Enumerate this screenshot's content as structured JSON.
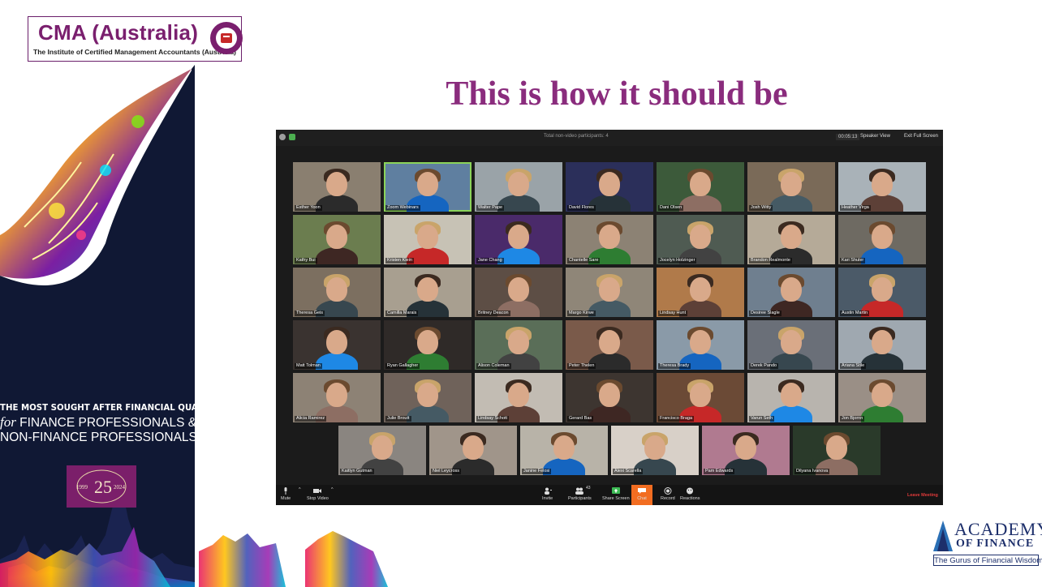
{
  "logo": {
    "name": "CMA (Australia)",
    "subtitle": "The Institute of Certified Management Accountants (Australia)"
  },
  "heading": "This is how it should be",
  "tagline": {
    "line1": "THE MOST SOUGHT AFTER FINANCIAL QUALIFICATION",
    "line2_italic": "for",
    "line2_rest": "FINANCE PROFESSIONALS &",
    "line3": "NON-FINANCE PROFESSIONALS"
  },
  "anniversary": {
    "start": "1999",
    "number": "25",
    "end": "2024"
  },
  "zoom": {
    "window_title": "Total non-video participants: 4",
    "timer": "00:05:13",
    "speaker_view": "Speaker View",
    "exit_full_screen": "Exit Full Screen",
    "participants": [
      "Esther Yoon",
      "Zoom Webinars",
      "Walter Pape",
      "David Flores",
      "Dani Olsen",
      "Josh Witty",
      "Heather Virga",
      "Kathy Bui",
      "Kristen Klein",
      "Jane Chang",
      "Chantelle Sare",
      "Jocelyn Holzinger",
      "Brandon Realmonte",
      "Kari Shuler",
      "Theresa Geis",
      "Camilla Marais",
      "Britney Deacon",
      "Margo Kirwe",
      "Lindsay Hunt",
      "Desiree Slagle",
      "Austin Martin",
      "Matt Tolman",
      "Ryan Gallagher",
      "Alison Coleman",
      "Peter Thelen",
      "Theresa Brady",
      "Derek Pando",
      "Ariana Stile",
      "Alicia Ramirez",
      "Julie Broutt",
      "Lindsay Schott",
      "Gerard Bas",
      "Francisco Braga",
      "Varun Seth",
      "Jon Bjornn",
      "Kaitlyn Gutman",
      "Niel Leycross",
      "Janine Felosi",
      "Alexi Scarella",
      "Pam Edwards",
      "Dilyana Ivanova"
    ],
    "toolbar": {
      "mute": "Mute",
      "stop_video": "Stop Video",
      "invite": "Invite",
      "participants": "Participants",
      "participants_count": "43",
      "share_screen": "Share Screen",
      "chat": "Chat",
      "record": "Record",
      "reactions": "Reactions",
      "leave": "Leave Meeting"
    }
  },
  "academy": {
    "name": "ACADEMY",
    "sub": "OF FINANCE",
    "tagline": "The Gurus of Financial Wisdom"
  },
  "colors": {
    "brand_purple": "#8a2c7d",
    "navy": "#0f1630",
    "zoom_green": "#8bd35a",
    "chat_orange": "#f26d21",
    "leave_red": "#e03a3a"
  }
}
